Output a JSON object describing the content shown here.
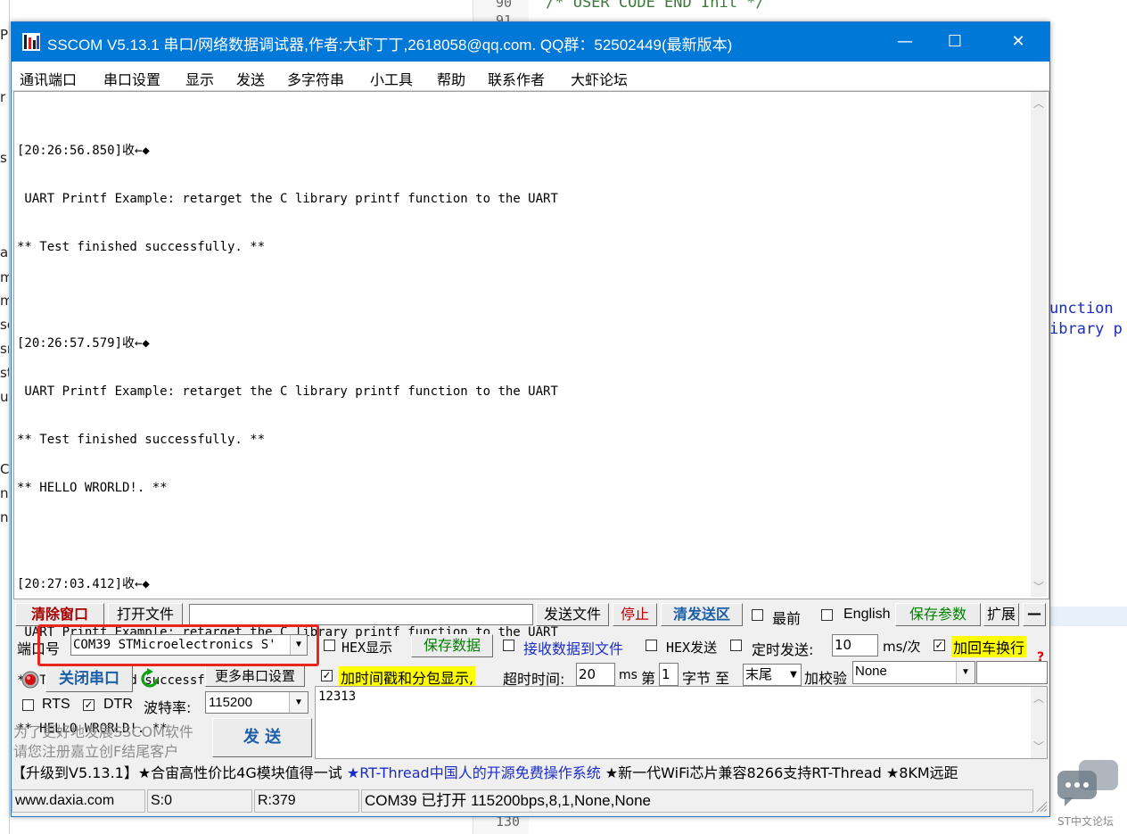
{
  "window": {
    "title": "SSCOM V5.13.1 串口/网络数据调试器,作者:大虾丁丁,2618058@qq.com. QQ群：52502449(最新版本)",
    "minimize": "—",
    "maximize": "☐",
    "close": "✕"
  },
  "menu": [
    "通讯端口",
    "串口设置",
    "显示",
    "发送",
    "多字符串",
    "小工具",
    "帮助",
    "联系作者",
    "大虾论坛"
  ],
  "receive": {
    "lines": [
      "[20:26:56.850]收←◆",
      " UART Printf Example: retarget the C library printf function to the UART",
      "** Test finished successfully. **",
      "",
      "[20:26:57.579]收←◆",
      " UART Printf Example: retarget the C library printf function to the UART",
      "** Test finished successfully. **",
      "** HELLO WRORLD!. **",
      "",
      "[20:27:03.412]收←◆",
      " UART Printf Example: retarget the C library printf function to the UART",
      "** Test finished successfully. **",
      "** HELLO WRORLD!. **"
    ]
  },
  "toolbar1": {
    "clear": "清除窗口",
    "open_file": "打开文件",
    "send_file": "发送文件",
    "stop": "停止",
    "clear_send": "清发送区",
    "topmost": "最前",
    "english": "English",
    "save_params": "保存参数",
    "expand": "扩展",
    "collapse": "—"
  },
  "row2": {
    "port_label": "端口号",
    "port_value": "COM39 STMicroelectronics S'",
    "hex_display": "HEX显示",
    "save_data": "保存数据",
    "recv_to_file": "接收数据到文件",
    "hex_send": "HEX发送",
    "timed_send": "定时发送:",
    "timed_value": "10",
    "timed_unit": "ms/次",
    "crlf": "加回车换行"
  },
  "row3": {
    "close_port": "关闭串口",
    "more_settings": "更多串口设置",
    "timestamp": "加时间戳和分包显示,",
    "timeout_label": "超时时间:",
    "timeout_value": "20",
    "timeout_unit": "ms",
    "di": "第",
    "byte_value": "1",
    "byte_to": "字节 至",
    "end_value": "末尾",
    "checksum_label": "加校验",
    "checksum_value": "None"
  },
  "row4": {
    "rts": "RTS",
    "dtr": "DTR",
    "baud_label": "波特率:",
    "baud_value": "115200",
    "send_text": "12313"
  },
  "promo": {
    "line1": "为了更好地发展SSCOM软件",
    "line2": "请您注册嘉立创F结尾客户",
    "send": "发  送"
  },
  "ticker": {
    "part1": "【升级到V5.13.1】★合宙高性价比4G模块值得一试 ",
    "part2": "★RT-Thread中国人的开源免费操作系统",
    "part3": " ★新一代WiFi芯片兼容8266支持RT-Thread ★8KM远距"
  },
  "status": {
    "site": "www.daxia.com",
    "s": "S:0",
    "r": "R:379",
    "info": "COM39 已打开  115200bps,8,1,None,None"
  },
  "background": {
    "line_numbers": [
      "90",
      "91",
      "130"
    ],
    "code_top": "/* USER CODE END Init */",
    "code_right1": "unction",
    "code_right2": "ibrary p",
    "left_chars": [
      "P",
      "r",
      "s",
      "ai",
      "m",
      "m",
      "so",
      "sr",
      "st",
      "u",
      "C0",
      "n",
      "n"
    ],
    "watermark": "ST中文论坛"
  },
  "colors": {
    "titlebar": "#0078d7",
    "highlight": "#e8261f",
    "green_text": "#008000",
    "accent_red": "#a50000"
  }
}
